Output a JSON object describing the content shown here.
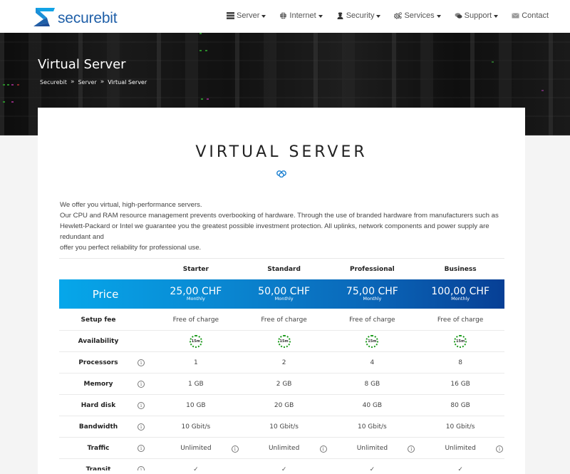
{
  "header": {
    "logo_text": "securebit",
    "nav": [
      {
        "label": "Server",
        "icon": "server-icon",
        "dropdown": true
      },
      {
        "label": "Internet",
        "icon": "globe-icon",
        "dropdown": true
      },
      {
        "label": "Security",
        "icon": "user-secret-icon",
        "dropdown": true
      },
      {
        "label": "Services",
        "icon": "cogs-icon",
        "dropdown": true
      },
      {
        "label": "Support",
        "icon": "chat-icon",
        "dropdown": true
      },
      {
        "label": "Contact",
        "icon": "envelope-icon",
        "dropdown": false
      }
    ]
  },
  "hero": {
    "title": "Virtual Server",
    "breadcrumb": [
      "Securebit",
      "Server",
      "Virtual Server"
    ],
    "breadcrumb_separator": "»"
  },
  "section": {
    "title": "VIRTUAL SERVER",
    "intro": [
      "We offer you virtual, high-performance servers.",
      "Our CPU and RAM resource management prevents overbooking of hardware. Through the use of branded hardware from manufacturers such as Hewlett-Packard or Intel we guarantee you the greatest possible investment protection. All uplinks, network components and power supply are redundant and",
      "offer you perfect reliability for professional use."
    ]
  },
  "colors": {
    "brand": "#1f5fa8",
    "price_gradient_start": "#06a7ea",
    "price_gradient_end": "#073f95",
    "availability_green": "#1a9a1a"
  },
  "plans": {
    "names": [
      "Starter",
      "Standard",
      "Professional",
      "Business"
    ],
    "price_label": "Price",
    "prices": [
      "25,00 CHF",
      "50,00 CHF",
      "75,00 CHF",
      "100,00 CHF"
    ],
    "period": "Monthly",
    "info_glyph": "i",
    "check_glyph": "✓",
    "availability_badge": "15m",
    "rows": [
      {
        "label": "Setup fee",
        "info": false,
        "values": [
          "Free of charge",
          "Free of charge",
          "Free of charge",
          "Free of charge"
        ]
      },
      {
        "label": "Availability",
        "info": false,
        "values": [
          "15m",
          "15m",
          "15m",
          "15m"
        ]
      },
      {
        "label": "Processors",
        "info": true,
        "values": [
          "1",
          "2",
          "4",
          "8"
        ]
      },
      {
        "label": "Memory",
        "info": true,
        "values": [
          "1 GB",
          "2 GB",
          "8 GB",
          "16 GB"
        ]
      },
      {
        "label": "Hard disk",
        "info": true,
        "values": [
          "10 GB",
          "20 GB",
          "40 GB",
          "80 GB"
        ]
      },
      {
        "label": "Bandwidth",
        "info": true,
        "values": [
          "10 Gbit/s",
          "10 Gbit/s",
          "10 Gbit/s",
          "10 Gbit/s"
        ]
      },
      {
        "label": "Traffic",
        "info": true,
        "values": [
          "Unlimited",
          "Unlimited",
          "Unlimited",
          "Unlimited"
        ]
      },
      {
        "label": "Transit",
        "info": true,
        "values": [
          "✓",
          "✓",
          "✓",
          "✓"
        ]
      }
    ]
  }
}
